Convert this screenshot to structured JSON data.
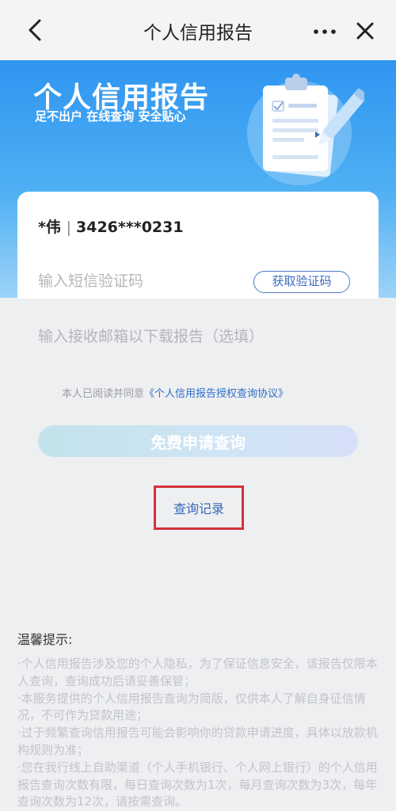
{
  "header": {
    "title": "个人信用报告",
    "back_icon": "chevron-left-icon",
    "more_icon": "more-horizontal-icon",
    "close_icon": "close-icon"
  },
  "banner": {
    "title": "个人信用报告",
    "subtitle": "足不出户 在线查询 安全贴心",
    "illustration": "clipboard-pencil-icon",
    "colors": {
      "top": "#2f95f0",
      "bottom": "#9dd3f8"
    }
  },
  "form": {
    "user_name": "*伟",
    "user_id": "3426***0231",
    "sms_placeholder": "输入短信验证码",
    "get_code_label": "获取验证码",
    "email_placeholder": "输入接收邮箱以下载报告（选填）",
    "agreement_prefix": "本人已阅读并同意",
    "agreement_link": "《个人信用报告授权查询协议》",
    "apply_label": "免费申请查询",
    "records_label": "查询记录"
  },
  "tips": {
    "title": "温馨提示:",
    "items": [
      "·个人信用报告涉及您的个人隐私，为了保证信息安全，该报告仅限本人查询，查询成功后请妥善保管；",
      "·本服务提供的个人信用报告查询为简版，仅供本人了解自身征信情况，不可作为贷款用途；",
      "·过于频繁查询信用报告可能会影响你的贷款申请进度，具体以放款机构规则为准；",
      "·您在我行线上自助渠道（个人手机银行、个人网上银行）的个人信用报告查询次数有限，每日查询次数为1次，每月查询次数为3次，每年查询次数为12次，请按需查询。"
    ]
  },
  "colors": {
    "accent": "#2f6fc9",
    "highlight_border": "#d2323a",
    "page_bg": "#eeeff1"
  }
}
